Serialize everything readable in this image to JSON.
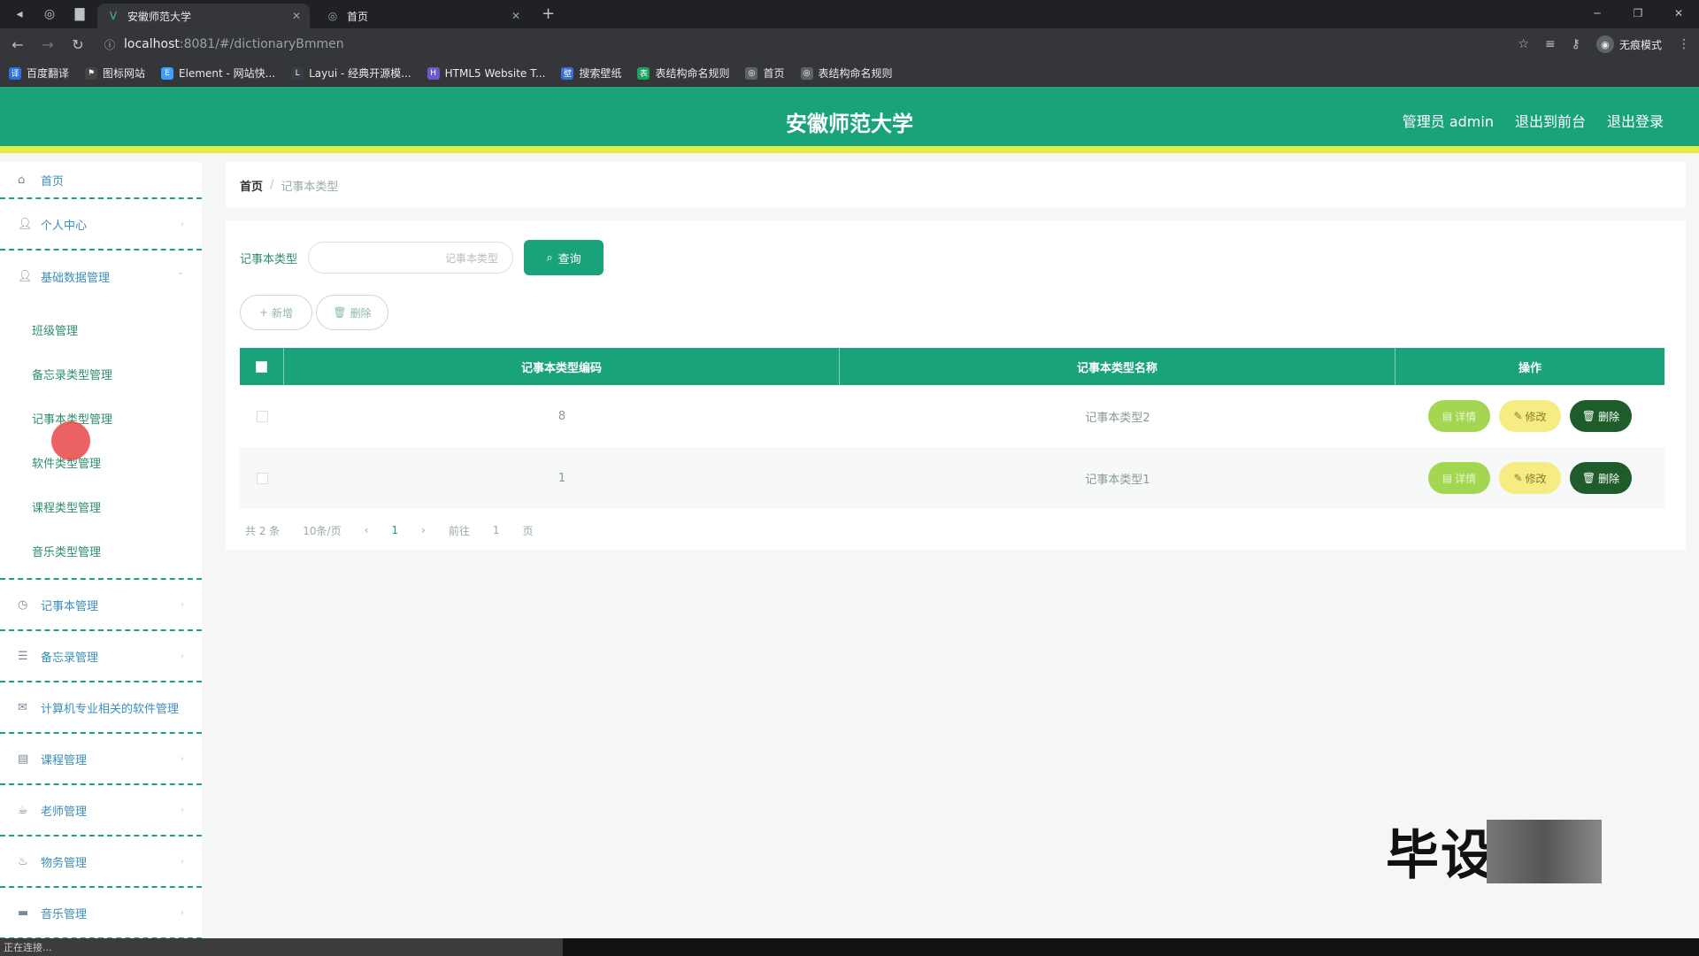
{
  "browser": {
    "tabs": [
      {
        "title": "安徽师范大学",
        "active": true
      },
      {
        "title": "首页",
        "active": false
      }
    ],
    "url_host": "localhost",
    "url_path": ":8081/#/dictionaryBmmen",
    "incognito_label": "无痕模式",
    "bookmarks": [
      "百度翻译",
      "图标网站",
      "Element - 网站快...",
      "Layui - 经典开源模...",
      "HTML5 Website T...",
      "搜索壁纸",
      "表结构命名规则",
      "首页",
      "表结构命名规则"
    ]
  },
  "header": {
    "title": "安徽师范大学",
    "admin_label": "管理员 admin",
    "back_front": "退出到前台",
    "logout": "退出登录"
  },
  "sidebar": {
    "home": "首页",
    "personal": "个人中心",
    "basic_data": "基础数据管理",
    "sub_items": [
      "班级管理",
      "备忘录类型管理",
      "记事本类型管理",
      "软件类型管理",
      "课程类型管理",
      "音乐类型管理"
    ],
    "items": [
      "记事本管理",
      "备忘录管理",
      "计算机专业相关的软件管理",
      "课程管理",
      "老师管理",
      "物务管理",
      "音乐管理"
    ]
  },
  "breadcrumb": {
    "home": "首页",
    "current": "记事本类型"
  },
  "search": {
    "label": "记事本类型",
    "placeholder": "记事本类型",
    "button": "查询"
  },
  "actions": {
    "add": "新增",
    "delete": "删除"
  },
  "table": {
    "headers": [
      "记事本类型编码",
      "记事本类型名称",
      "操作"
    ],
    "rows": [
      {
        "code": "8",
        "name": "记事本类型2"
      },
      {
        "code": "1",
        "name": "记事本类型1"
      }
    ],
    "ops": {
      "detail": "详情",
      "edit": "修改",
      "delete": "删除"
    }
  },
  "pager": {
    "total": "共 2 条",
    "per_page": "10条/页",
    "page": "1",
    "goto": "前往",
    "goto_page": "1",
    "page_suffix": "页"
  },
  "watermark": "毕设",
  "status": "正在连接..."
}
